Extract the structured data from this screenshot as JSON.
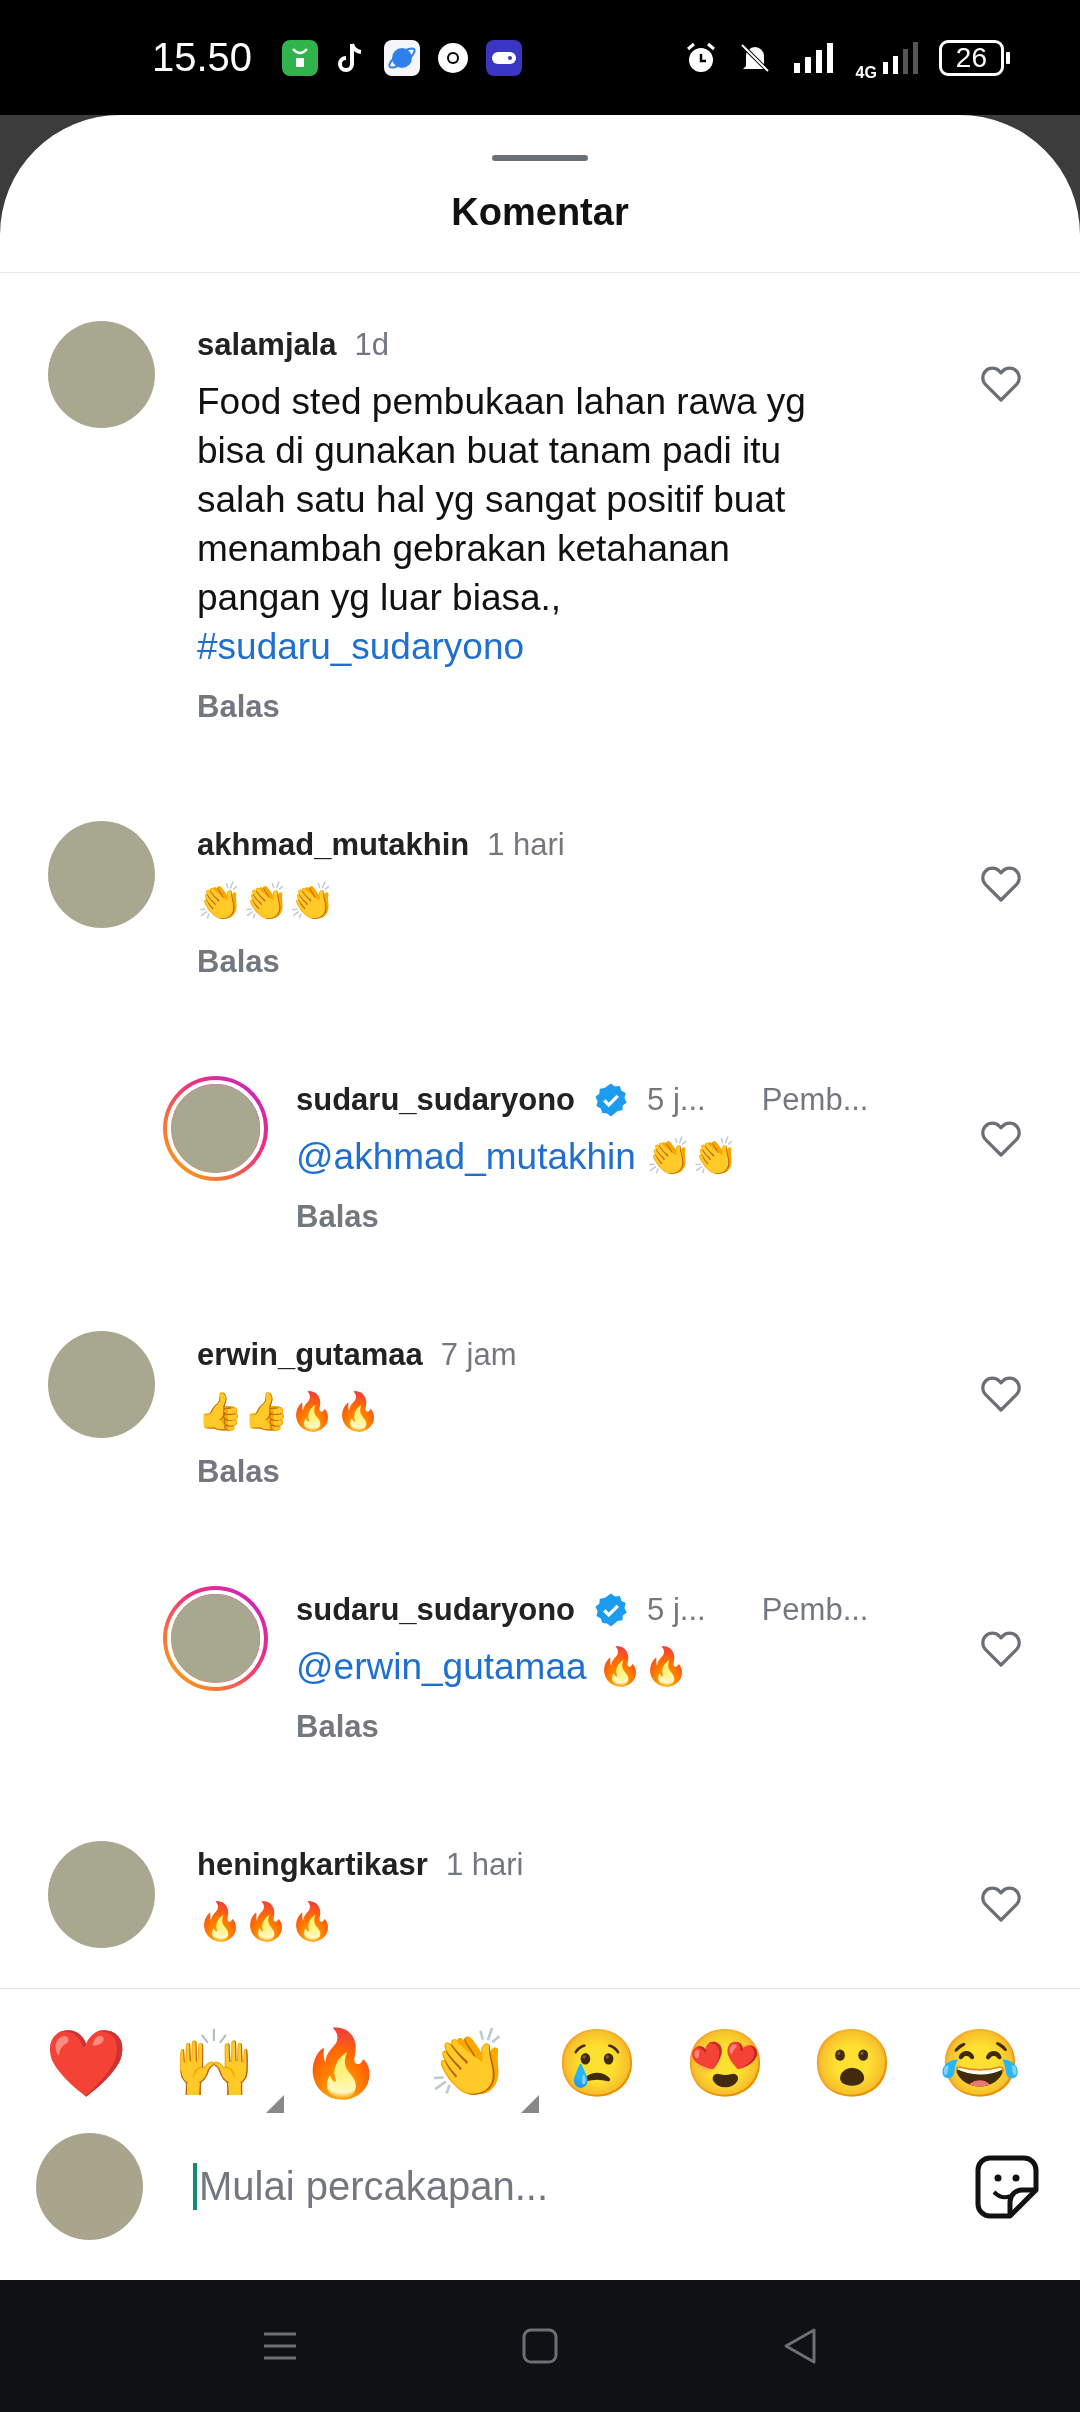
{
  "status_bar": {
    "time": "15.50",
    "network": "4G",
    "battery": "26"
  },
  "sheet": {
    "title": "Komentar"
  },
  "comments": [
    {
      "username": "salamjala",
      "verified": false,
      "time": "1d",
      "reply": false,
      "story_ring": false,
      "body": [
        {
          "kind": "plain",
          "text": "Food sted pembukaan lahan rawa yg bisa di gunakan buat tanam padi itu salah satu hal yg sangat positif buat menambah gebrakan ketahanan pangan yg luar biasa., "
        },
        {
          "kind": "link",
          "text": "#sudaru_sudaryono"
        }
      ],
      "reply_label": "Balas"
    },
    {
      "username": "akhmad_mutakhin",
      "verified": false,
      "time": "1 hari",
      "reply": false,
      "story_ring": false,
      "body": [
        {
          "kind": "plain",
          "text": "👏👏👏"
        }
      ],
      "reply_label": "Balas"
    },
    {
      "username": "sudaru_sudaryono",
      "verified": true,
      "time": "5 j...",
      "role": "Pemb...",
      "reply": true,
      "story_ring": true,
      "body": [
        {
          "kind": "link",
          "text": "@akhmad_mutakhin"
        },
        {
          "kind": "plain",
          "text": " 👏👏"
        }
      ],
      "reply_label": "Balas"
    },
    {
      "username": "erwin_gutamaa",
      "verified": false,
      "time": "7 jam",
      "reply": false,
      "story_ring": false,
      "body": [
        {
          "kind": "plain",
          "text": "👍👍🔥🔥"
        }
      ],
      "reply_label": "Balas"
    },
    {
      "username": "sudaru_sudaryono",
      "verified": true,
      "time": "5 j...",
      "role": "Pemb...",
      "reply": true,
      "story_ring": true,
      "body": [
        {
          "kind": "link",
          "text": "@erwin_gutamaa"
        },
        {
          "kind": "plain",
          "text": " 🔥🔥"
        }
      ],
      "reply_label": "Balas"
    },
    {
      "username": "heningkartikasr",
      "verified": false,
      "time": "1 hari",
      "reply": false,
      "story_ring": false,
      "body": [
        {
          "kind": "plain",
          "text": "🔥🔥🔥"
        }
      ]
    }
  ],
  "reactions": [
    {
      "emoji": "❤️",
      "has_variants": false
    },
    {
      "emoji": "🙌",
      "has_variants": true
    },
    {
      "emoji": "🔥",
      "has_variants": false
    },
    {
      "emoji": "👏",
      "has_variants": true
    },
    {
      "emoji": "😢",
      "has_variants": false
    },
    {
      "emoji": "😍",
      "has_variants": false
    },
    {
      "emoji": "😮",
      "has_variants": false
    },
    {
      "emoji": "😂",
      "has_variants": false
    }
  ],
  "composer": {
    "placeholder": "Mulai percakapan..."
  }
}
